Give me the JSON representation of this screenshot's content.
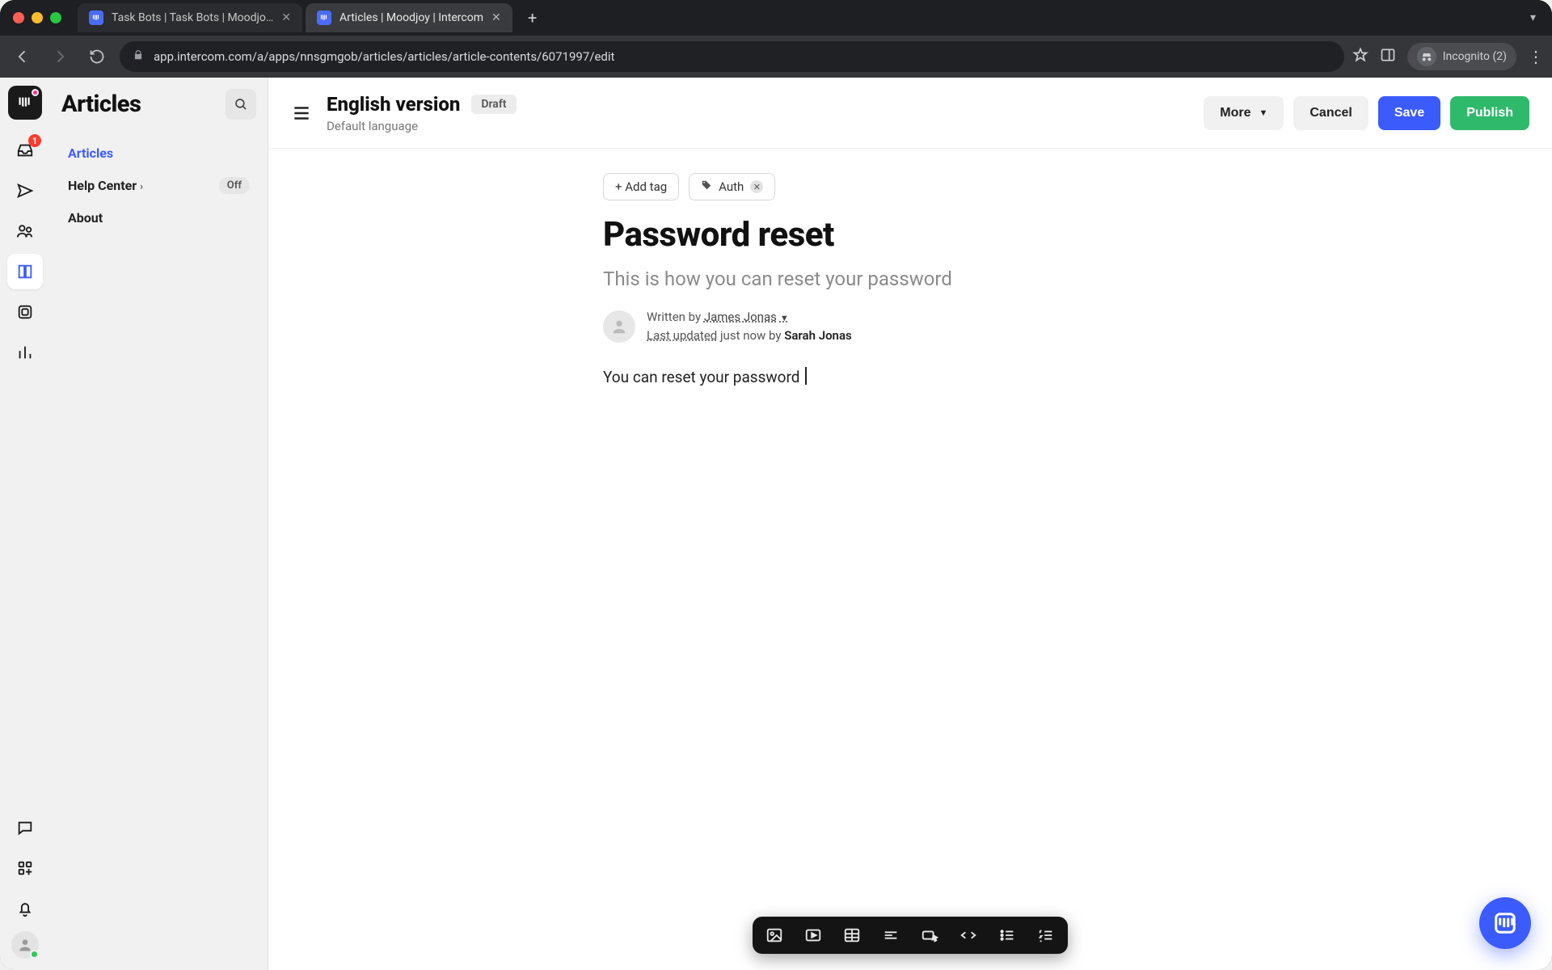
{
  "browser": {
    "tabs": [
      {
        "title": "Task Bots | Task Bots | Moodjo…",
        "active": false
      },
      {
        "title": "Articles | Moodjoy | Intercom",
        "active": true
      }
    ],
    "url": "app.intercom.com/a/apps/nnsgmgob/articles/articles/article-contents/6071997/edit",
    "incognito_label": "Incognito (2)"
  },
  "rail": {
    "inbox_badge": "1"
  },
  "sidebar": {
    "title": "Articles",
    "items": [
      {
        "label": "Articles",
        "active": true
      },
      {
        "label": "Help Center",
        "badge": "Off",
        "chevron": true
      },
      {
        "label": "About"
      }
    ]
  },
  "topbar": {
    "title": "English version",
    "status": "Draft",
    "subtitle": "Default language",
    "more": "More",
    "cancel": "Cancel",
    "save": "Save",
    "publish": "Publish"
  },
  "editor": {
    "add_tag": "+ Add tag",
    "tags": [
      {
        "label": "Auth"
      }
    ],
    "title": "Password reset",
    "subtitle": "This is how you can reset your password",
    "written_by_prefix": "Written by ",
    "author": "James Jonas",
    "last_updated_label": "Last updated",
    "last_updated_rest": " just now by ",
    "editor_name": "Sarah Jonas",
    "body": "You can reset your password "
  }
}
